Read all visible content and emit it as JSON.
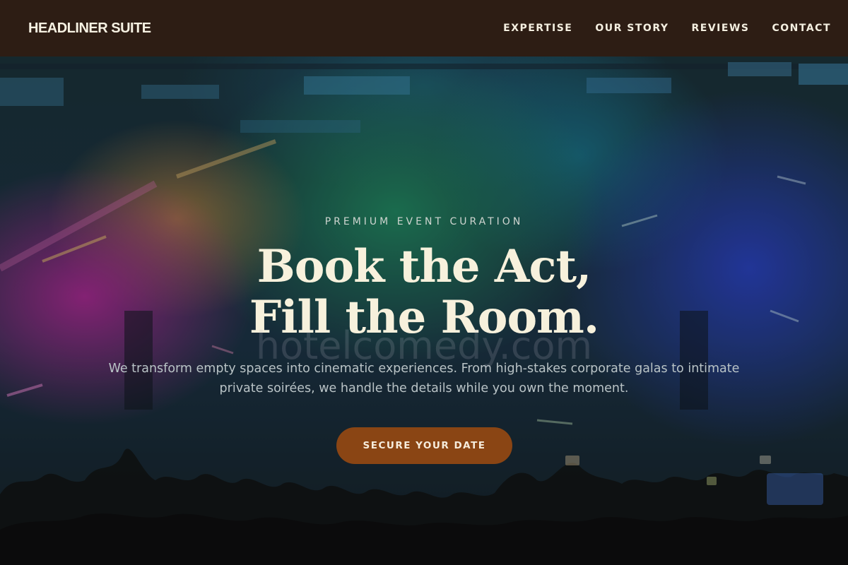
{
  "nav": {
    "brand": "HEADLINER SUITE",
    "links": [
      "EXPERTISE",
      "OUR STORY",
      "REVIEWS",
      "CONTACT"
    ]
  },
  "hero": {
    "eyebrow": "PREMIUM EVENT CURATION",
    "headline_line1": "Book the Act,",
    "headline_line2": "Fill the Room.",
    "watermark": "hotelcomedy.com",
    "tagline": "We transform empty spaces into cinematic experiences. From high-stakes corporate galas to intimate private soirées, we handle the details while you own the moment.",
    "cta_label": "SECURE YOUR DATE",
    "background_image": "concert-crowd-stage-lights"
  },
  "colors": {
    "nav_bg": "#2d1d14",
    "headline": "#f7f1dc",
    "cta_bg": "#8a4514",
    "cta_text": "#f6ecdc"
  }
}
